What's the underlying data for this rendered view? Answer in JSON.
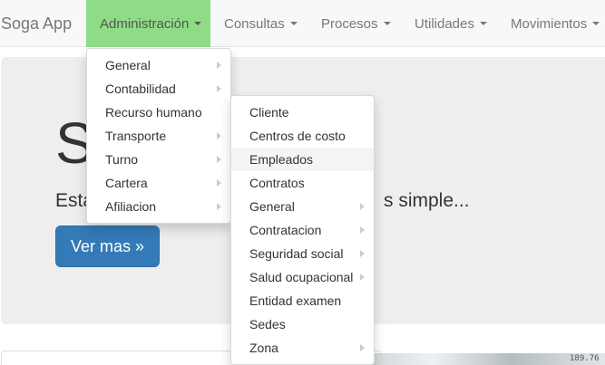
{
  "brand": "Soga App",
  "nav": {
    "items": [
      {
        "label": "Administración"
      },
      {
        "label": "Consultas"
      },
      {
        "label": "Procesos"
      },
      {
        "label": "Utilidades"
      },
      {
        "label": "Movimientos"
      }
    ],
    "active_color": "#8fdc86"
  },
  "jumbotron": {
    "title": "S",
    "lead_left": "Esta",
    "lead_right": "s simple...",
    "button_label": "Ver mas »"
  },
  "menu1": {
    "items": [
      {
        "label": "General"
      },
      {
        "label": "Contabilidad"
      },
      {
        "label": "Recurso humano"
      },
      {
        "label": "Transporte"
      },
      {
        "label": "Turno"
      },
      {
        "label": "Cartera"
      },
      {
        "label": "Afiliacion"
      }
    ]
  },
  "menu2": {
    "items": [
      {
        "label": "Cliente"
      },
      {
        "label": "Centros de costo"
      },
      {
        "label": "Empleados"
      },
      {
        "label": "Contratos"
      },
      {
        "label": "General"
      },
      {
        "label": "Contratacion"
      },
      {
        "label": "Seguridad social"
      },
      {
        "label": "Salud ocupacional"
      },
      {
        "label": "Entidad examen"
      },
      {
        "label": "Sedes"
      },
      {
        "label": "Zona"
      }
    ]
  },
  "image_text": "189.76",
  "colors": {
    "primary": "#337ab7",
    "jumbotron_bg": "#eeeeee"
  }
}
